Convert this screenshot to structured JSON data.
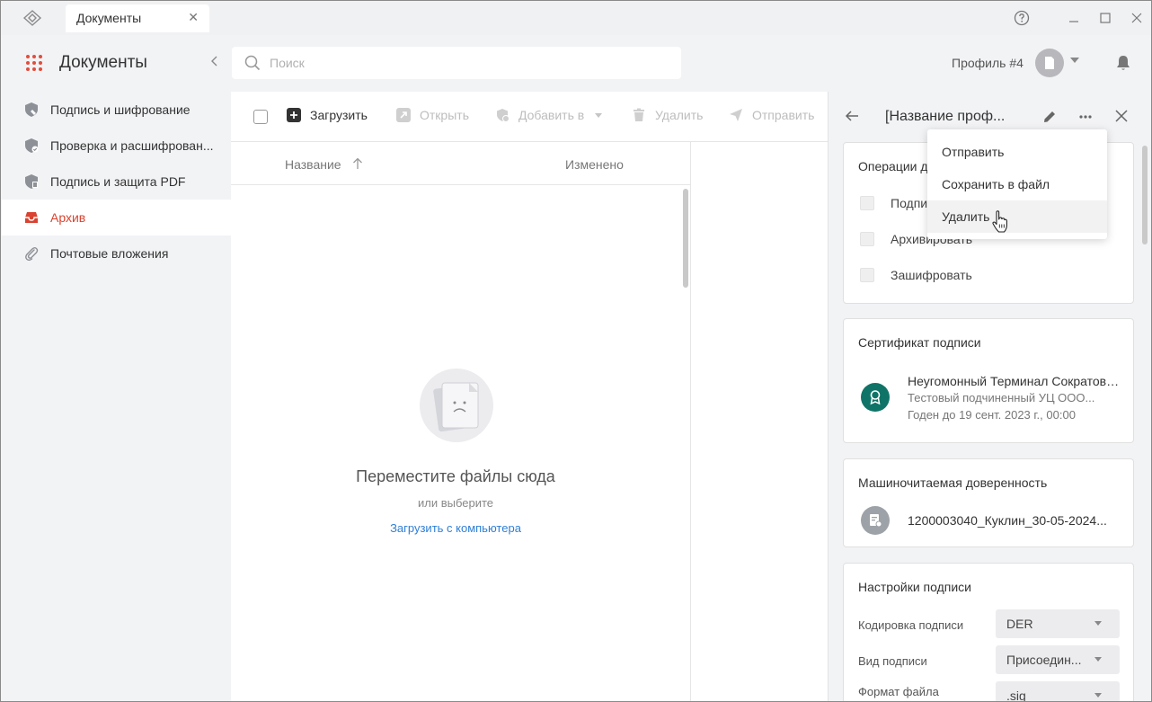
{
  "window": {
    "tab_title": "Документы"
  },
  "header": {
    "app_title": "Документы",
    "search_placeholder": "Поиск",
    "profile_name": "Профиль #4"
  },
  "sidebar": {
    "items": [
      {
        "label": "Подпись и шифрование",
        "icon": "shield-icon"
      },
      {
        "label": "Проверка и расшифрован...",
        "icon": "shield-check-icon"
      },
      {
        "label": "Подпись и защита PDF",
        "icon": "shield-pdf-icon"
      },
      {
        "label": "Архив",
        "icon": "archive-icon",
        "active": true
      },
      {
        "label": "Почтовые вложения",
        "icon": "paperclip-icon"
      }
    ]
  },
  "toolbar": {
    "upload": "Загрузить",
    "open": "Открыть",
    "add_to": "Добавить в",
    "delete": "Удалить",
    "send": "Отправить"
  },
  "file_list": {
    "col_name": "Название",
    "col_changed": "Изменено",
    "empty_title": "Переместите файлы сюда",
    "empty_sub": "или выберите",
    "empty_link": "Загрузить с компьютера"
  },
  "details": {
    "title": "[Название проф...",
    "operations": {
      "title": "Операции д",
      "items": [
        "Подпис",
        "Архивировать",
        "Зашифровать"
      ]
    },
    "certificate": {
      "title": "Сертификат подписи",
      "name": "Неугомонный Терминал Сократови...",
      "issuer": "Тестовый подчиненный УЦ ООО...",
      "valid": "Годен до 19 сент. 2023 г., 00:00"
    },
    "power_of_attorney": {
      "title": "Машиночитаемая доверенность",
      "file": "1200003040_Куклин_30-05-2024..."
    },
    "settings": {
      "title": "Настройки подписи",
      "encoding_label": "Кодировка подписи",
      "encoding_value": "DER",
      "type_label": "Вид подписи",
      "type_value": "Присоедин...",
      "format_label": "Формат файла",
      "format_value": ".sig"
    }
  },
  "context_menu": {
    "items": [
      "Отправить",
      "Сохранить в файл",
      "Удалить"
    ],
    "hovered_index": 2
  },
  "colors": {
    "accent": "#d9432f",
    "link": "#2f7fd6",
    "cert_badge": "#0f7467"
  }
}
